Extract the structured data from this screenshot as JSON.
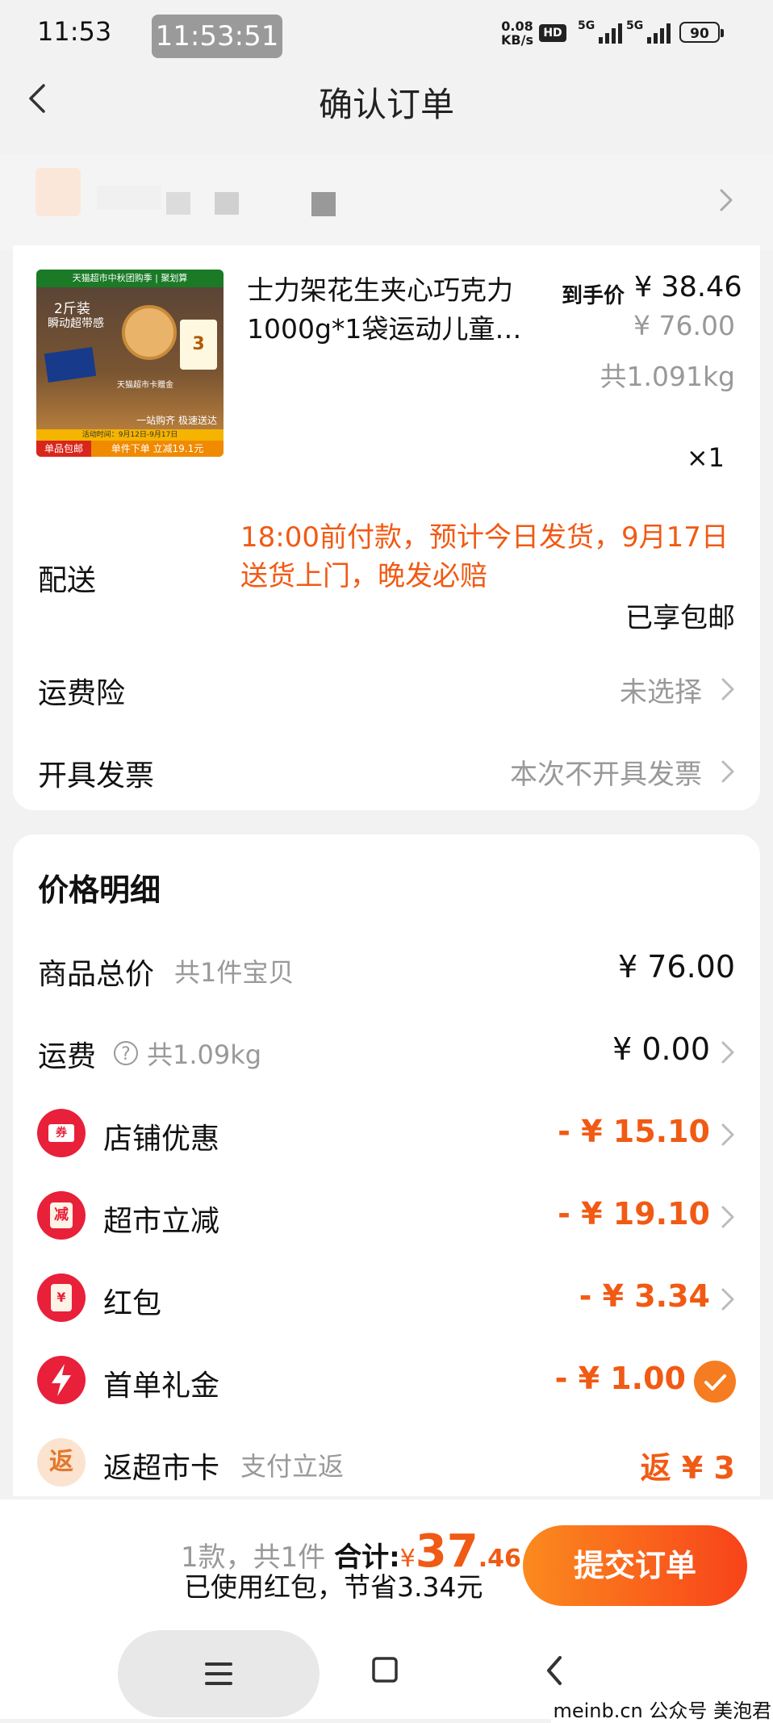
{
  "status_bar": {
    "time": "11:53",
    "time_pill": "11:53:51",
    "net_speed_value": "0.08",
    "net_speed_unit": "KB/s",
    "hd_label": "HD",
    "net1": "5G",
    "net2": "5G",
    "battery": "90"
  },
  "header": {
    "title": "确认订单"
  },
  "product": {
    "title": "士力架花生夹心巧克力1000g*1袋运动儿童…",
    "final_price_label": "到手价",
    "final_price": "¥ 38.46",
    "original_price": "¥ 76.00",
    "weight": "共1.091kg",
    "quantity": "×1",
    "image": {
      "banner": "天猫超市中秋团购季 | 聚划算",
      "pack_label": "2斤装",
      "pack_sub": "瞬动超带感",
      "coupon_days": "3",
      "coupon_note": "天猫超市卡赠金",
      "promo_date": "活动时间：9月12日-9月17日",
      "promo_slogan": "一站购齐 极速送达",
      "free_ship_tag": "单品包邮",
      "discount_tag": "单件下单 立减19.1元"
    }
  },
  "delivery": {
    "label": "配送",
    "text": "18:00前付款，预计今日发货，9月17日送货上门，晚发必赔",
    "free_shipping": "已享包邮"
  },
  "insurance": {
    "label": "运费险",
    "value": "未选择"
  },
  "invoice": {
    "label": "开具发票",
    "value": "本次不开具发票"
  },
  "price_detail": {
    "title": "价格明细",
    "goods_total": {
      "label": "商品总价",
      "sub": "共1件宝贝",
      "value": "¥ 76.00"
    },
    "shipping": {
      "label": "运费",
      "sub": "共1.09kg",
      "value": "¥ 0.00"
    },
    "shop_discount": {
      "label": "店铺优惠",
      "value": "- ¥ 15.10",
      "icon_char": "券"
    },
    "market_cut": {
      "label": "超市立减",
      "value": "- ¥ 19.10",
      "icon_char": "减"
    },
    "red_packet": {
      "label": "红包",
      "value": "- ¥ 3.34",
      "icon_char": "¥"
    },
    "first_order_gift": {
      "label": "首单礼金",
      "value": "- ¥ 1.00"
    },
    "market_card": {
      "label": "返超市卡",
      "sub": "支付立返",
      "value": "返 ¥ 3",
      "icon_char": "返"
    }
  },
  "bottom": {
    "count": "1款，共1件",
    "total_label": "合计:",
    "currency": "¥",
    "total_int": "37",
    "total_dec": ".46",
    "saving": "已使用红包，节省3.34元",
    "submit": "提交订单"
  },
  "watermark": "meinb.cn 公众号 美泡君",
  "colors": {
    "accent": "#f15a14",
    "button": "#fa5a16"
  }
}
